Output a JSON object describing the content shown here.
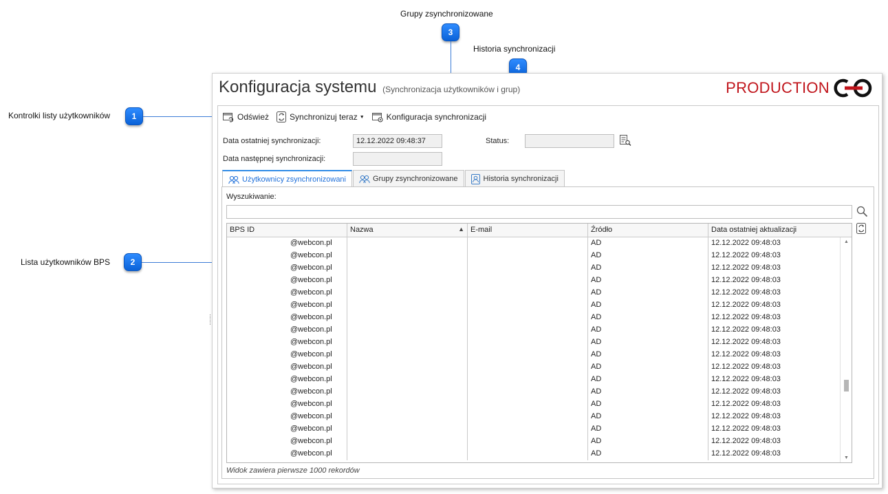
{
  "callouts": [
    {
      "num": "1",
      "label": "Kontrolki listy użytkowników"
    },
    {
      "num": "2",
      "label": "Lista użytkowników BPS"
    },
    {
      "num": "3",
      "label": "Grupy zsynchronizowane"
    },
    {
      "num": "4",
      "label": "Historia synchronizacji"
    }
  ],
  "window": {
    "title": "Konfiguracja systemu",
    "subtitle": "(Synchronizacja użytkowników i grup)",
    "brand": "PRODUCTION",
    "brand_color": "#c0141b"
  },
  "toolbar": {
    "refresh_label": "Odśwież",
    "sync_now_label": "Synchronizuj teraz",
    "sync_config_label": "Konfiguracja synchronizacji"
  },
  "fields": {
    "last_sync_label": "Data ostatniej synchronizacji:",
    "last_sync_value": "12.12.2022 09:48:37",
    "next_sync_label": "Data następnej synchronizacji:",
    "next_sync_value": "",
    "status_label": "Status:",
    "status_value": ""
  },
  "tabs": [
    {
      "label": "Użytkownicy zsynchronizowani",
      "active": true
    },
    {
      "label": "Grupy zsynchronizowane",
      "active": false
    },
    {
      "label": "Historia synchronizacji",
      "active": false
    }
  ],
  "search": {
    "label": "Wyszukiwanie:",
    "value": ""
  },
  "grid": {
    "columns": [
      "BPS ID",
      "Nazwa",
      "E-mail",
      "Źródło",
      "Data ostatniej aktualizacji"
    ],
    "sort_column": "Nazwa",
    "rows": [
      [
        "@webcon.pl",
        "",
        "",
        "AD",
        "12.12.2022 09:48:03"
      ],
      [
        "@webcon.pl",
        "",
        "",
        "AD",
        "12.12.2022 09:48:03"
      ],
      [
        "@webcon.pl",
        "",
        "",
        "AD",
        "12.12.2022 09:48:03"
      ],
      [
        "@webcon.pl",
        "",
        "",
        "AD",
        "12.12.2022 09:48:03"
      ],
      [
        "@webcon.pl",
        "",
        "",
        "AD",
        "12.12.2022 09:48:03"
      ],
      [
        "@webcon.pl",
        "",
        "",
        "AD",
        "12.12.2022 09:48:03"
      ],
      [
        "@webcon.pl",
        "",
        "",
        "AD",
        "12.12.2022 09:48:03"
      ],
      [
        "@webcon.pl",
        "",
        "",
        "AD",
        "12.12.2022 09:48:03"
      ],
      [
        "@webcon.pl",
        "",
        "",
        "AD",
        "12.12.2022 09:48:03"
      ],
      [
        "@webcon.pl",
        "",
        "",
        "AD",
        "12.12.2022 09:48:03"
      ],
      [
        "@webcon.pl",
        "",
        "",
        "AD",
        "12.12.2022 09:48:03"
      ],
      [
        "@webcon.pl",
        "",
        "",
        "AD",
        "12.12.2022 09:48:03"
      ],
      [
        "@webcon.pl",
        "",
        "",
        "AD",
        "12.12.2022 09:48:03"
      ],
      [
        "@webcon.pl",
        "",
        "",
        "AD",
        "12.12.2022 09:48:03"
      ],
      [
        "@webcon.pl",
        "",
        "",
        "AD",
        "12.12.2022 09:48:03"
      ],
      [
        "@webcon.pl",
        "",
        "",
        "AD",
        "12.12.2022 09:48:03"
      ],
      [
        "@webcon.pl",
        "",
        "",
        "AD",
        "12.12.2022 09:48:03"
      ],
      [
        "@webcon.pl",
        "",
        "",
        "AD",
        "12.12.2022 09:48:03"
      ]
    ],
    "footer": "Widok zawiera pierwsze 1000 rekordów"
  },
  "accent_color": "#1e6fd9"
}
